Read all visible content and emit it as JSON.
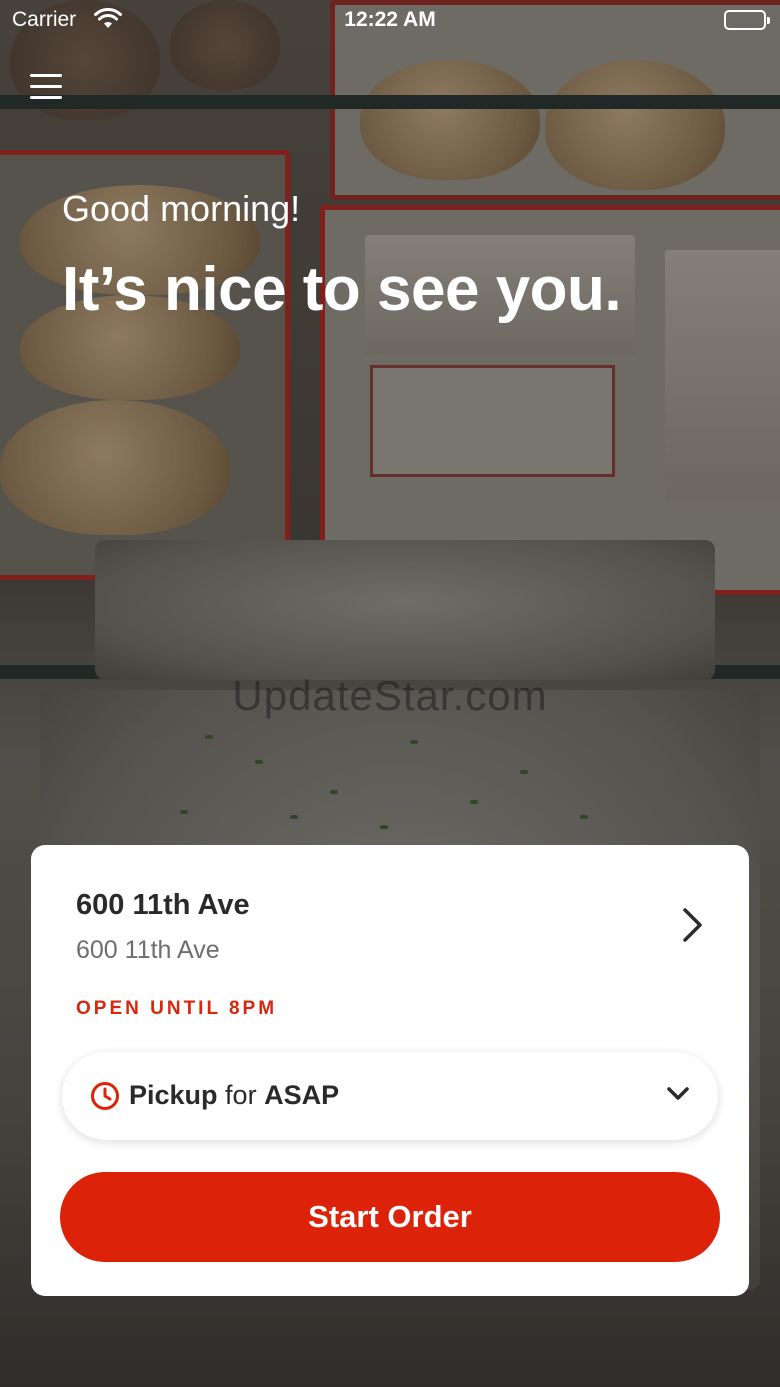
{
  "status_bar": {
    "carrier": "Carrier",
    "time": "12:22 AM"
  },
  "greeting": {
    "line1": "Good morning!",
    "line2": "It’s nice to see you."
  },
  "watermark": "UpdateStar.com",
  "location": {
    "name": "600 11th Ave",
    "address": "600 11th Ave",
    "hours_status": "OPEN UNTIL 8PM"
  },
  "pickup": {
    "mode": "Pickup",
    "connector": "for",
    "time": "ASAP"
  },
  "start_order": {
    "label": "Start Order"
  },
  "colors": {
    "accent": "#dc2209",
    "card": "#ffffff",
    "text": "#2a2a2a",
    "muted": "#6e6e6e"
  },
  "icons": [
    "menu-icon",
    "wifi-icon",
    "battery-icon",
    "chevron-right-icon",
    "clock-icon",
    "chevron-down-icon"
  ]
}
